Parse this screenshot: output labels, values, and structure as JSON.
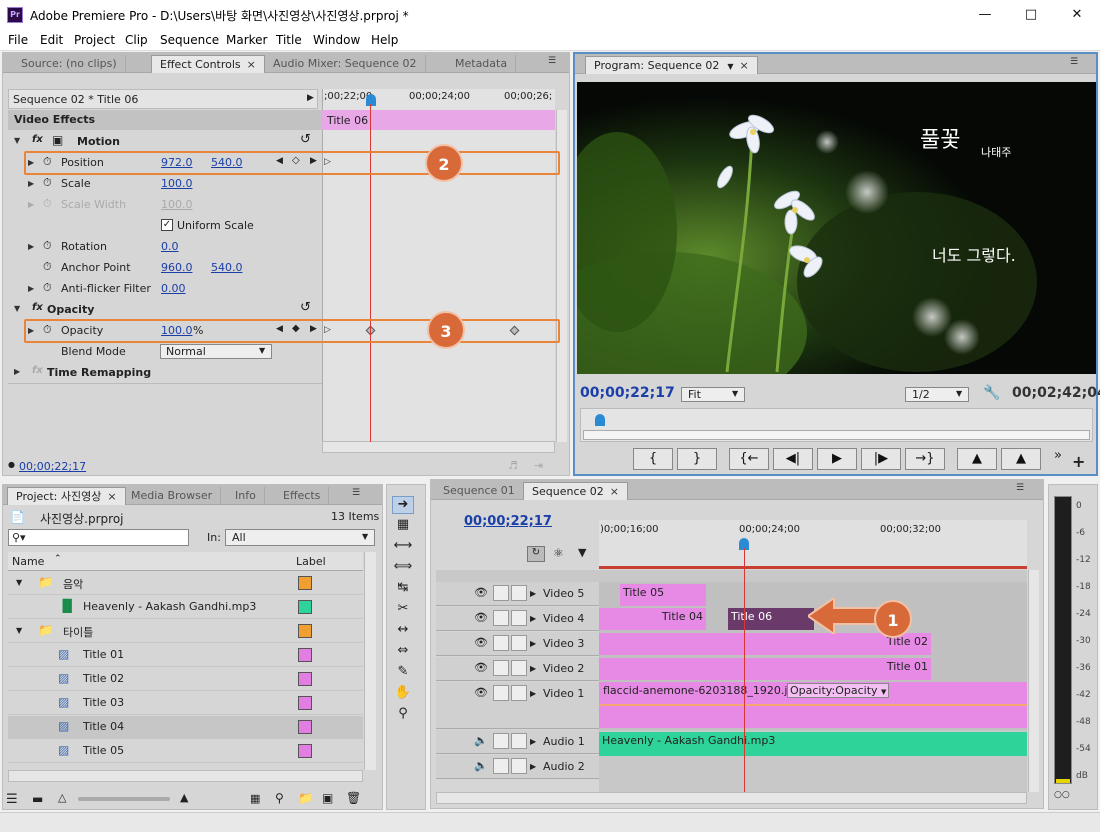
{
  "window": {
    "title": "Adobe Premiere Pro - D:\\Users\\바탕 화면\\사진영상\\사진영상.prproj *",
    "app_icon": "Pr",
    "controls": [
      "minimize-icon",
      "maximize-icon",
      "close-icon"
    ]
  },
  "menu": [
    "File",
    "Edit",
    "Project",
    "Clip",
    "Sequence",
    "Marker",
    "Title",
    "Window",
    "Help"
  ],
  "effect_controls": {
    "tabs": [
      "Source: (no clips)",
      "Effect Controls",
      "Audio Mixer: Sequence 02",
      "Metadata"
    ],
    "sequence_label": "Sequence 02 * Title 06",
    "ruler": [
      ";00;22;00",
      "00;00;24;00",
      "00;00;26;"
    ],
    "clip_label": "Title 06",
    "section": "Video Effects",
    "motion_label": "Motion",
    "position": {
      "label": "Position",
      "x": "972.0",
      "y": "540.0"
    },
    "scale": {
      "label": "Scale",
      "value": "100.0"
    },
    "scale_width": {
      "label": "Scale Width",
      "value": "100.0"
    },
    "uniform_scale": "Uniform Scale",
    "rotation": {
      "label": "Rotation",
      "value": "0.0"
    },
    "anchor": {
      "label": "Anchor Point",
      "x": "960.0",
      "y": "540.0"
    },
    "antiflicker": {
      "label": "Anti-flicker Filter",
      "value": "0.00"
    },
    "opacity_section": "Opacity",
    "opacity": {
      "label": "Opacity",
      "value": "100.0",
      "unit": "%"
    },
    "blend": {
      "label": "Blend Mode",
      "value": "Normal"
    },
    "time_remap": "Time Remapping",
    "timecode": "00;00;22;17"
  },
  "callouts": [
    "1",
    "2",
    "3"
  ],
  "program": {
    "tab": "Program: Sequence 02",
    "title_text": "풀꽃",
    "author": "나태주",
    "line": "너도 그렇다.",
    "timecode": "00;00;22;17",
    "fit": "Fit",
    "res": "1/2",
    "duration": "00;02;42;04"
  },
  "project": {
    "tabs": [
      "Project: 사진영상",
      "Media Browser",
      "Info",
      "Effects"
    ],
    "file": "사진영상.prproj",
    "items": "13 Items",
    "in_label": "In:",
    "in_value": "All",
    "col_name": "Name",
    "col_label": "Label",
    "rows": [
      {
        "name": "음악",
        "color": "#f0a030",
        "kind": "folder",
        "indent": 0
      },
      {
        "name": "Heavenly - Aakash Gandhi.mp3",
        "color": "#2ed39a",
        "kind": "audio",
        "indent": 1
      },
      {
        "name": "타이틀",
        "color": "#f0a030",
        "kind": "folder",
        "indent": 0
      },
      {
        "name": "Title 01",
        "color": "#e27ee2",
        "kind": "title",
        "indent": 1
      },
      {
        "name": "Title 02",
        "color": "#e27ee2",
        "kind": "title",
        "indent": 1
      },
      {
        "name": "Title 03",
        "color": "#e27ee2",
        "kind": "title",
        "indent": 1
      },
      {
        "name": "Title 04",
        "color": "#e27ee2",
        "kind": "title",
        "indent": 1
      },
      {
        "name": "Title 05",
        "color": "#e27ee2",
        "kind": "title",
        "indent": 1
      }
    ]
  },
  "timeline": {
    "tabs": [
      "Sequence 01",
      "Sequence 02"
    ],
    "timecode": "00;00;22;17",
    "ruler": [
      ")0;00;16;00",
      "00;00;24;00",
      "00;00;32;00"
    ],
    "tracks": [
      "Video 5",
      "Video 4",
      "Video 3",
      "Video 2",
      "Video 1",
      "Audio 1",
      "Audio 2"
    ],
    "clips": {
      "v5": "Title 05",
      "v4a": "Title 04",
      "v4b": "Title 06",
      "v3": "Title 02",
      "v2": "Title 01",
      "v1": "flaccid-anemone-6203188_1920.jpg",
      "v1_fx": "Opacity:Opacity",
      "a1": "Heavenly - Aakash Gandhi.mp3"
    }
  },
  "meter": {
    "ticks": [
      "0",
      "-6",
      "-12",
      "-18",
      "-24",
      "-30",
      "-36",
      "-42",
      "-48",
      "-54",
      "dB"
    ]
  },
  "colors": {
    "accent_orange": "#e8853b",
    "playhead": "#d93636",
    "clip_pink": "#e27ee2",
    "clip_audio": "#2ed39a",
    "clip_selected": "#6a3a6a"
  }
}
